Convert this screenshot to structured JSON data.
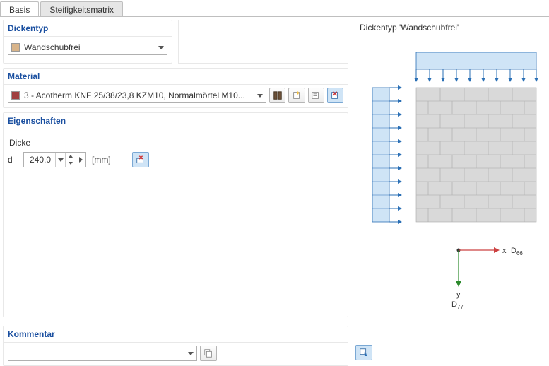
{
  "tabs": {
    "basis": "Basis",
    "stiff": "Steifigkeitsmatrix"
  },
  "dickentyp": {
    "header": "Dickentyp",
    "value": "Wandschubfrei"
  },
  "material": {
    "header": "Material",
    "value": "3 - Acotherm KNF 25/38/23,8 KZM10, Normalmörtel M10..."
  },
  "props": {
    "header": "Eigenschaften",
    "dicke_label": "Dicke",
    "d_label": "d",
    "d_value": "240.0",
    "unit": "[mm]"
  },
  "kommentar": {
    "header": "Kommentar",
    "value": ""
  },
  "preview": {
    "title_prefix": "Dickentyp  ",
    "title_value": "'Wandschubfrei'",
    "axis_x": "x",
    "axis_y": "y",
    "d66": "D",
    "d66_sub": "66",
    "d77": "D",
    "d77_sub": "77"
  }
}
